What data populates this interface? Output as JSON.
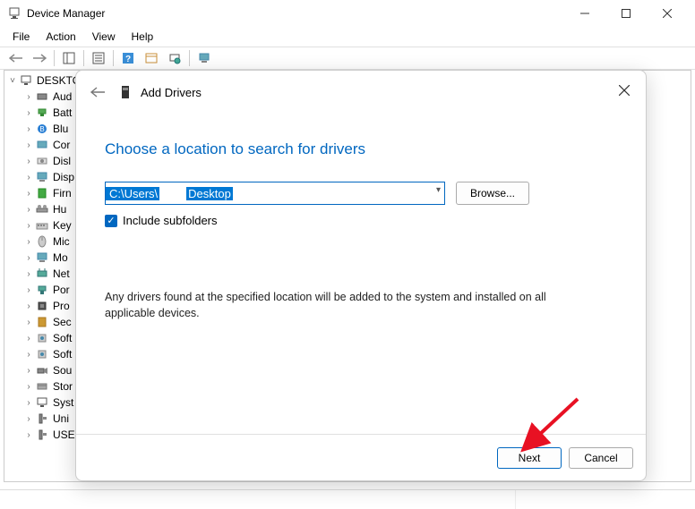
{
  "window": {
    "title": "Device Manager"
  },
  "menu": {
    "file": "File",
    "action": "Action",
    "view": "View",
    "help": "Help"
  },
  "tree": {
    "root": "DESKTO",
    "items": [
      {
        "label": "Aud"
      },
      {
        "label": "Batt"
      },
      {
        "label": "Blu"
      },
      {
        "label": "Cor"
      },
      {
        "label": "Disl"
      },
      {
        "label": "Disp"
      },
      {
        "label": "Firn"
      },
      {
        "label": "Hu"
      },
      {
        "label": "Key"
      },
      {
        "label": "Mic"
      },
      {
        "label": "Mo"
      },
      {
        "label": "Net"
      },
      {
        "label": "Por"
      },
      {
        "label": "Pro"
      },
      {
        "label": "Sec"
      },
      {
        "label": "Soft"
      },
      {
        "label": "Soft"
      },
      {
        "label": "Sou"
      },
      {
        "label": "Stor"
      },
      {
        "label": "Syst"
      },
      {
        "label": "Uni"
      },
      {
        "label": "USE"
      }
    ]
  },
  "dialog": {
    "title": "Add Drivers",
    "heading": "Choose a location to search for drivers",
    "path_prefix": "C:\\Users\\",
    "path_suffix": "Desktop",
    "browse": "Browse...",
    "include_subfolders": "Include subfolders",
    "info": "Any drivers found at the specified location will be added to the system and installed on all applicable devices.",
    "next": "Next",
    "cancel": "Cancel"
  }
}
